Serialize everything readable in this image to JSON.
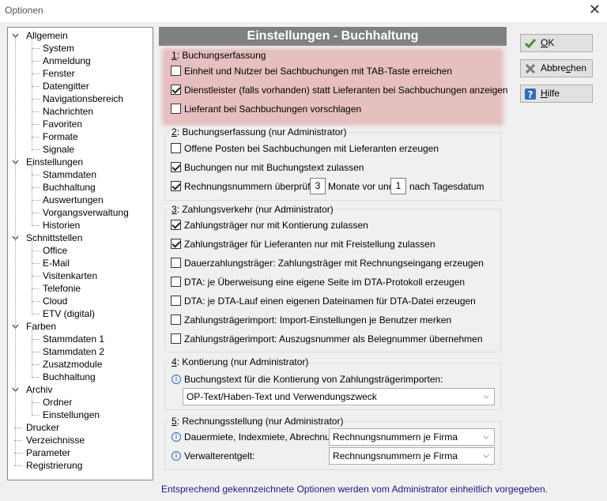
{
  "window": {
    "title": "Optionen",
    "close_glyph": "✕"
  },
  "tree": {
    "root1": "Allgemein",
    "allgemein": [
      "System",
      "Anmeldung",
      "Fenster",
      "Datengitter",
      "Navigationsbereich",
      "Nachrichten",
      "Favoriten",
      "Formate",
      "Signale"
    ],
    "root2": "Einstellungen",
    "einstellungen": [
      "Stammdaten",
      "Buchhaltung",
      "Auswertungen",
      "Vorgangsverwaltung",
      "Historien"
    ],
    "root3": "Schnittstellen",
    "schnittstellen": [
      "Office",
      "E-Mail",
      "Visitenkarten",
      "Telefonie",
      "Cloud",
      "ETV (digital)"
    ],
    "root4": "Farben",
    "farben": [
      "Stammdaten 1",
      "Stammdaten 2",
      "Zusatzmodule",
      "Buchhaltung"
    ],
    "root5": "Archiv",
    "archiv": [
      "Ordner",
      "Einstellungen"
    ],
    "root6": "Drucker",
    "root7": "Verzeichnisse",
    "root8": "Parameter",
    "root9": "Registrierung"
  },
  "panel": {
    "title": "Einstellungen - Buchhaltung",
    "g1": {
      "num": "1",
      "title": ": Buchungserfassung",
      "items": [
        {
          "label": "Einheit und Nutzer bei Sachbuchungen mit TAB-Taste erreichen",
          "checked": false
        },
        {
          "label": "Dienstleister (falls vorhanden) statt Lieferanten bei Sachbuchungen anzeigen",
          "checked": true
        },
        {
          "label": "Lieferant bei Sachbuchungen vorschlagen",
          "checked": false
        }
      ]
    },
    "g2": {
      "num": "2",
      "title": ": Buchungserfassung  (nur Administrator)",
      "items": [
        {
          "label": "Offene Posten bei Sachbuchungen mit Lieferanten erzeugen",
          "checked": false
        },
        {
          "label": "Buchungen nur mit Buchungstext zulassen",
          "checked": true
        }
      ],
      "rn": {
        "label": "Rechnungsnummern überprüfen:",
        "months": "3",
        "mid": "Monate vor und",
        "days": "1",
        "end": "nach Tagesdatum",
        "checked": true
      }
    },
    "g3": {
      "num": "3",
      "title": ": Zahlungsverkehr  (nur Administrator)",
      "items": [
        {
          "label": "Zahlungsträger nur mit Kontierung zulassen",
          "checked": true
        },
        {
          "label": "Zahlungsträger für Lieferanten nur mit Freistellung zulassen",
          "checked": true
        },
        {
          "label": "Dauerzahlungsträger: Zahlungsträger mit Rechnungseingang erzeugen",
          "checked": false
        },
        {
          "label": "DTA: je Überweisung eine eigene Seite im DTA-Protokoll erzeugen",
          "checked": false
        },
        {
          "label": "DTA: je DTA-Lauf einen eigenen Dateinamen für DTA-Datei erzeugen",
          "checked": false
        },
        {
          "label": "Zahlungsträgerimport: Import-Einstellungen je Benutzer merken",
          "checked": false
        },
        {
          "label": "Zahlungsträgerimport: Auszugsnummer als Belegnummer übernehmen",
          "checked": false
        }
      ]
    },
    "g4": {
      "num": "4",
      "title": ": Kontierung  (nur Administrator)",
      "label": "Buchungstext für die Kontierung von Zahlungsträgerimporten:",
      "value": "OP-Text/Haben-Text und Verwendungszweck"
    },
    "g5": {
      "num": "5",
      "title": ": Rechnungsstellung  (nur Administrator)",
      "row1": {
        "label": "Dauermiete, Indexmiete, Abrechnung:",
        "value": "Rechnungsnummern je Firma"
      },
      "row2": {
        "label": "Verwalterentgelt:",
        "value": "Rechnungsnummern je Firma"
      }
    }
  },
  "buttons": {
    "ok": {
      "prefix": "",
      "ul": "O",
      "suffix": "K"
    },
    "cancel": {
      "prefix": "Abbre",
      "ul": "c",
      "suffix": "hen"
    },
    "help": {
      "prefix": "",
      "ul": "H",
      "suffix": "ilfe"
    }
  },
  "footer": "Entsprechend gekennzeichnete Optionen werden vom Administrator einheitlich vorgegeben.",
  "colors": {
    "highlight": "#e6bfbf",
    "header_bg": "#808080",
    "footer_text": "#1a1a8c"
  }
}
